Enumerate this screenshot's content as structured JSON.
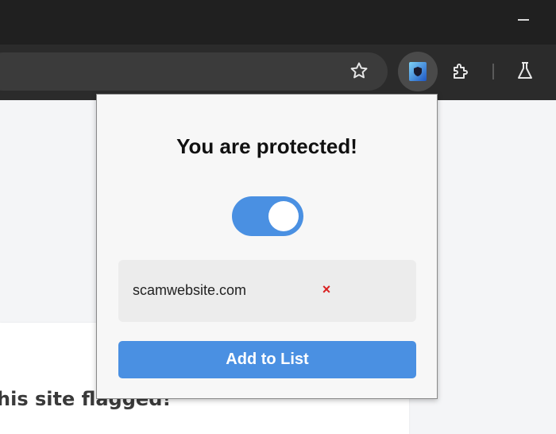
{
  "browser": {
    "toolbar_icons": [
      "star-icon",
      "shield-extension-icon",
      "puzzle-icon",
      "flask-icon"
    ]
  },
  "page": {
    "card_heading": "his site flagged!"
  },
  "popup": {
    "title": "You are protected!",
    "protection_enabled": true,
    "list": [
      {
        "site": "scamwebsite.com",
        "remove_label": "×"
      }
    ],
    "add_button_label": "Add to List"
  },
  "colors": {
    "accent": "#4a90e2",
    "remove": "#d92020",
    "titlebar": "#202020",
    "toolbar": "#2b2b2b"
  }
}
